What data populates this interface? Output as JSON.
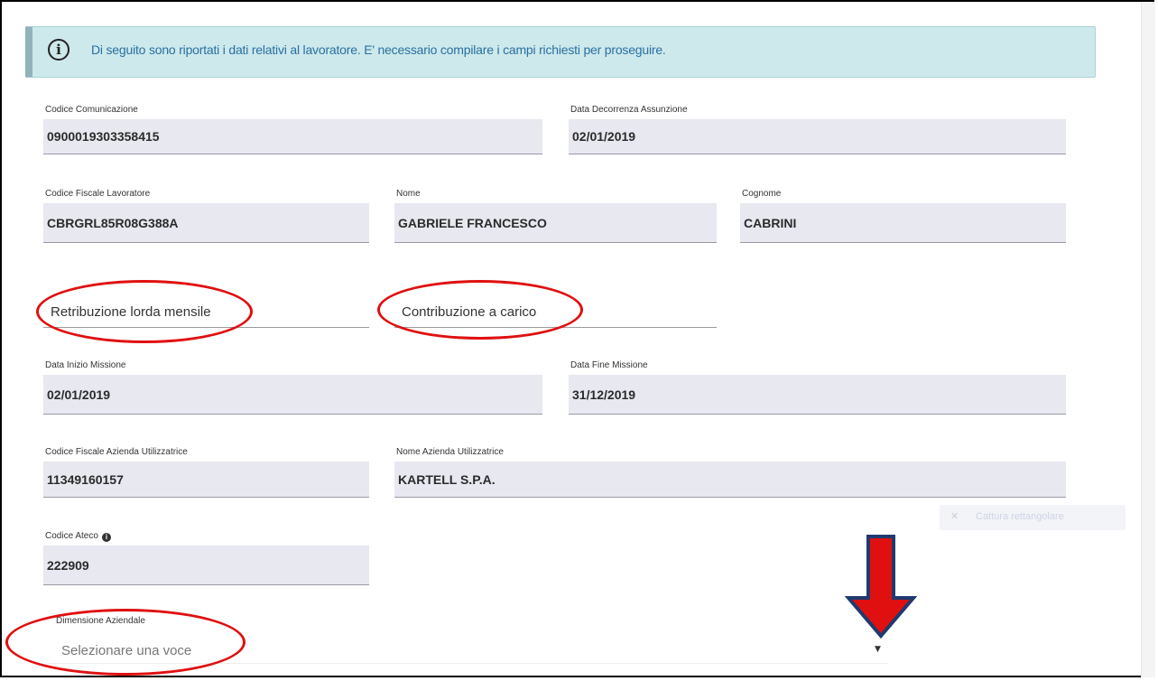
{
  "alert": {
    "icon": "info-icon",
    "text": "Di seguito sono riportati i dati relativi al lavoratore. E' necessario compilare i campi richiesti per proseguire."
  },
  "fields": {
    "codice_comunicazione": {
      "label": "Codice Comunicazione",
      "value": "0900019303358415"
    },
    "data_decorrenza": {
      "label": "Data Decorrenza Assunzione",
      "value": "02/01/2019"
    },
    "codice_fiscale": {
      "label": "Codice Fiscale Lavoratore",
      "value": "CBRGRL85R08G388A"
    },
    "nome": {
      "label": "Nome",
      "value": "GABRIELE FRANCESCO"
    },
    "cognome": {
      "label": "Cognome",
      "value": "CABRINI"
    },
    "retribuzione": {
      "placeholder": "Retribuzione lorda mensile"
    },
    "contribuzione": {
      "placeholder": "Contribuzione a carico"
    },
    "data_inizio": {
      "label": "Data Inizio Missione",
      "value": "02/01/2019"
    },
    "data_fine": {
      "label": "Data Fine Missione",
      "value": "31/12/2019"
    },
    "cf_azienda": {
      "label": "Codice Fiscale Azienda Utilizzatrice",
      "value": "11349160157"
    },
    "nome_azienda": {
      "label": "Nome Azienda Utilizzatrice",
      "value": "KARTELL S.P.A."
    },
    "codice_ateco": {
      "label": "Codice Ateco",
      "value": "222909"
    },
    "dimensione": {
      "label": "Dimensione Aziendale",
      "selected": "Selezionare una voce"
    }
  },
  "overlay": {
    "ghost_button_icon": "close-icon",
    "ghost_button_label": "Cattura rettangolare",
    "annotation_color": "#e01010",
    "arrow_color": "#e01010",
    "arrow_outline": "#1f3a6e"
  },
  "colors": {
    "alert_bg": "#cde9ec",
    "field_bg": "#e7e8f0",
    "alert_text": "#2a6fa0"
  }
}
